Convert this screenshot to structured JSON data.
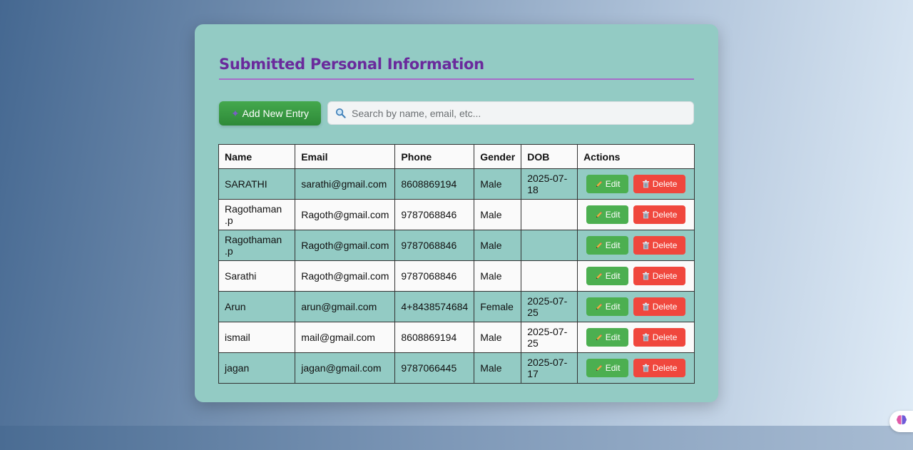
{
  "page": {
    "title": "Submitted Personal Information",
    "add_button_label": "Add New Entry",
    "add_button_icon": "sparkle-icon",
    "search": {
      "placeholder": "Search by name, email, etc...",
      "value": "",
      "icon": "search-icon"
    }
  },
  "table": {
    "columns": [
      "Name",
      "Email",
      "Phone",
      "Gender",
      "DOB",
      "Actions"
    ],
    "edit_label": "Edit",
    "delete_label": "Delete",
    "rows": [
      {
        "name": "SARATHI",
        "email": "sarathi@gmail.com",
        "phone": "8608869194",
        "gender": "Male",
        "dob": "2025-07-18"
      },
      {
        "name": "Ragothaman .p",
        "email": "Ragoth@gmail.com",
        "phone": "9787068846",
        "gender": "Male",
        "dob": ""
      },
      {
        "name": "Ragothaman .p",
        "email": "Ragoth@gmail.com",
        "phone": "9787068846",
        "gender": "Male",
        "dob": ""
      },
      {
        "name": "Sarathi",
        "email": "Ragoth@gmail.com",
        "phone": "9787068846",
        "gender": "Male",
        "dob": ""
      },
      {
        "name": "Arun",
        "email": "arun@gmail.com",
        "phone": "4+8438574684",
        "gender": "Female",
        "dob": "2025-07-25"
      },
      {
        "name": "ismail",
        "email": "mail@gmail.com",
        "phone": "8608869194",
        "gender": "Male",
        "dob": "2025-07-25"
      },
      {
        "name": "jagan",
        "email": "jagan@gmail.com",
        "phone": "9787066445",
        "gender": "Male",
        "dob": "2025-07-17"
      }
    ]
  },
  "colors": {
    "card_bg": "#93cbc4",
    "title": "#6a2a9c",
    "edit_button": "#4caf50",
    "delete_button": "#f0473d",
    "add_button": "#3a9a44"
  },
  "floating_badge": {
    "icon": "brain-icon"
  }
}
